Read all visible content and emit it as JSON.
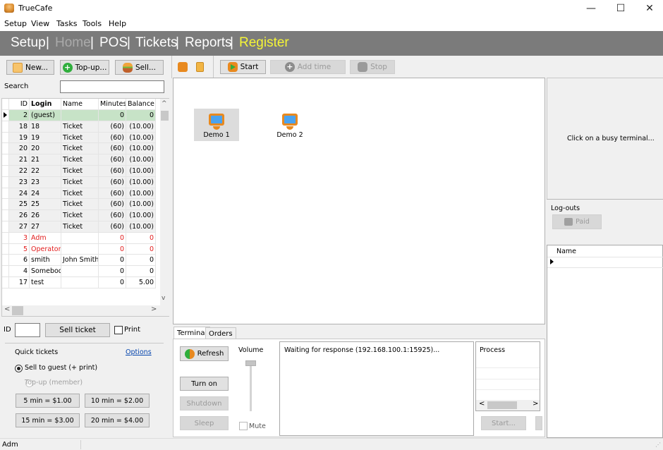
{
  "window": {
    "title": "TrueCafe",
    "minimize_glyph": "—",
    "maximize_glyph": "☐",
    "close_glyph": "✕"
  },
  "menu": [
    "Setup",
    "View",
    "Tasks",
    "Tools",
    "Help"
  ],
  "nav": {
    "items": [
      {
        "label": "Setup",
        "state": "normal"
      },
      {
        "label": "Home",
        "state": "disabled"
      },
      {
        "label": "POS",
        "state": "normal"
      },
      {
        "label": "Tickets",
        "state": "normal"
      },
      {
        "label": "Reports",
        "state": "normal"
      },
      {
        "label": "Register",
        "state": "active"
      }
    ],
    "separator": "|",
    "active_color": "#f5f537"
  },
  "left_toolbar": {
    "new": "New...",
    "topup": "Top-up...",
    "sell": "Sell..."
  },
  "search": {
    "label": "Search",
    "value": ""
  },
  "accounts": {
    "columns": [
      "ID",
      "Login",
      "Name",
      "Minutes",
      "Balance"
    ],
    "rows": [
      {
        "id": "2",
        "login": "(guest)",
        "name": "",
        "minutes": "0",
        "balance": "0",
        "style": "sel"
      },
      {
        "id": "18",
        "login": "18",
        "name": "Ticket",
        "minutes": "(60)",
        "balance": "(10.00)",
        "style": "ticket"
      },
      {
        "id": "19",
        "login": "19",
        "name": "Ticket",
        "minutes": "(60)",
        "balance": "(10.00)",
        "style": "ticket"
      },
      {
        "id": "20",
        "login": "20",
        "name": "Ticket",
        "minutes": "(60)",
        "balance": "(10.00)",
        "style": "ticket"
      },
      {
        "id": "21",
        "login": "21",
        "name": "Ticket",
        "minutes": "(60)",
        "balance": "(10.00)",
        "style": "ticket"
      },
      {
        "id": "22",
        "login": "22",
        "name": "Ticket",
        "minutes": "(60)",
        "balance": "(10.00)",
        "style": "ticket"
      },
      {
        "id": "23",
        "login": "23",
        "name": "Ticket",
        "minutes": "(60)",
        "balance": "(10.00)",
        "style": "ticket"
      },
      {
        "id": "24",
        "login": "24",
        "name": "Ticket",
        "minutes": "(60)",
        "balance": "(10.00)",
        "style": "ticket"
      },
      {
        "id": "25",
        "login": "25",
        "name": "Ticket",
        "minutes": "(60)",
        "balance": "(10.00)",
        "style": "ticket"
      },
      {
        "id": "26",
        "login": "26",
        "name": "Ticket",
        "minutes": "(60)",
        "balance": "(10.00)",
        "style": "ticket"
      },
      {
        "id": "27",
        "login": "27",
        "name": "Ticket",
        "minutes": "(60)",
        "balance": "(10.00)",
        "style": "ticket"
      },
      {
        "id": "3",
        "login": "Adm",
        "name": "",
        "minutes": "0",
        "balance": "0",
        "style": "red"
      },
      {
        "id": "5",
        "login": "Operator",
        "name": "",
        "minutes": "0",
        "balance": "0",
        "style": "red"
      },
      {
        "id": "6",
        "login": "smith",
        "name": "John Smith",
        "minutes": "0",
        "balance": "0",
        "style": ""
      },
      {
        "id": "4",
        "login": "Somebody",
        "name": "",
        "minutes": "0",
        "balance": "0",
        "style": ""
      },
      {
        "id": "17",
        "login": "test",
        "name": "",
        "minutes": "0",
        "balance": "5.00",
        "style": ""
      }
    ]
  },
  "sell_ticket": {
    "id_label": "ID",
    "id_value": "",
    "button": "Sell ticket",
    "print_label": "Print"
  },
  "quick_tickets": {
    "title": "Quick tickets",
    "options_link": "Options",
    "radio_guest": "Sell to guest (+ print)",
    "radio_topup": "Top-up (member)",
    "buttons": [
      "5 min = $1.00",
      "10 min = $2.00",
      "15 min = $3.00",
      "20 min = $4.00"
    ]
  },
  "terminal_toolbar": {
    "start": "Start",
    "add_time": "Add time",
    "stop": "Stop"
  },
  "terminals": [
    {
      "label": "Demo 1",
      "selected": true
    },
    {
      "label": "Demo 2",
      "selected": false
    }
  ],
  "right_panel": {
    "hint": "Click on a busy terminal...",
    "logouts_label": "Log-outs",
    "paid_button": "Paid",
    "name_column": "Name"
  },
  "bottom_tabs": [
    "Terminal",
    "Orders"
  ],
  "terminal_tab": {
    "refresh": "Refresh",
    "turn_on": "Turn on",
    "shutdown": "Shutdown",
    "sleep": "Sleep",
    "volume_label": "Volume",
    "mute_label": "Mute",
    "log_text": "Waiting for response (192.168.100.1:15925)...",
    "process_column": "Process",
    "start_button": "Start..."
  },
  "status": {
    "user": "Adm"
  }
}
